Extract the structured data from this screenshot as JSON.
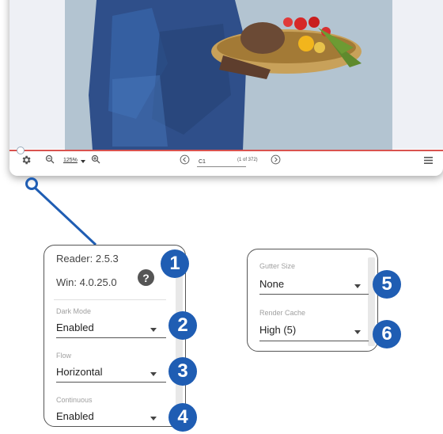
{
  "toolbar": {
    "zoom_value": "125%",
    "page_value": "C1",
    "page_count": "(1 of 372)",
    "icons": [
      "gear-icon",
      "zoom-out-icon",
      "zoom-in-icon",
      "prev-page-icon",
      "next-page-icon",
      "menu-icon"
    ]
  },
  "reading_progress": 0.01,
  "settings": {
    "reader_version": "Reader: 2.5.3",
    "win_version": "Win: 4.0.25.0",
    "dark_mode": {
      "label": "Dark Mode",
      "value": "Enabled"
    },
    "flow": {
      "label": "Flow",
      "value": "Horizontal"
    },
    "continuous": {
      "label": "Continuous",
      "value": "Enabled"
    },
    "gutter_size": {
      "label": "Gutter Size",
      "value": "None"
    },
    "render_cache": {
      "label": "Render Cache",
      "value": "High (5)"
    }
  },
  "badges": [
    "1",
    "2",
    "3",
    "4",
    "5",
    "6"
  ],
  "colors": {
    "badge": "#1f5db3",
    "progress": "#d9534f",
    "connector": "#1f5db3"
  }
}
